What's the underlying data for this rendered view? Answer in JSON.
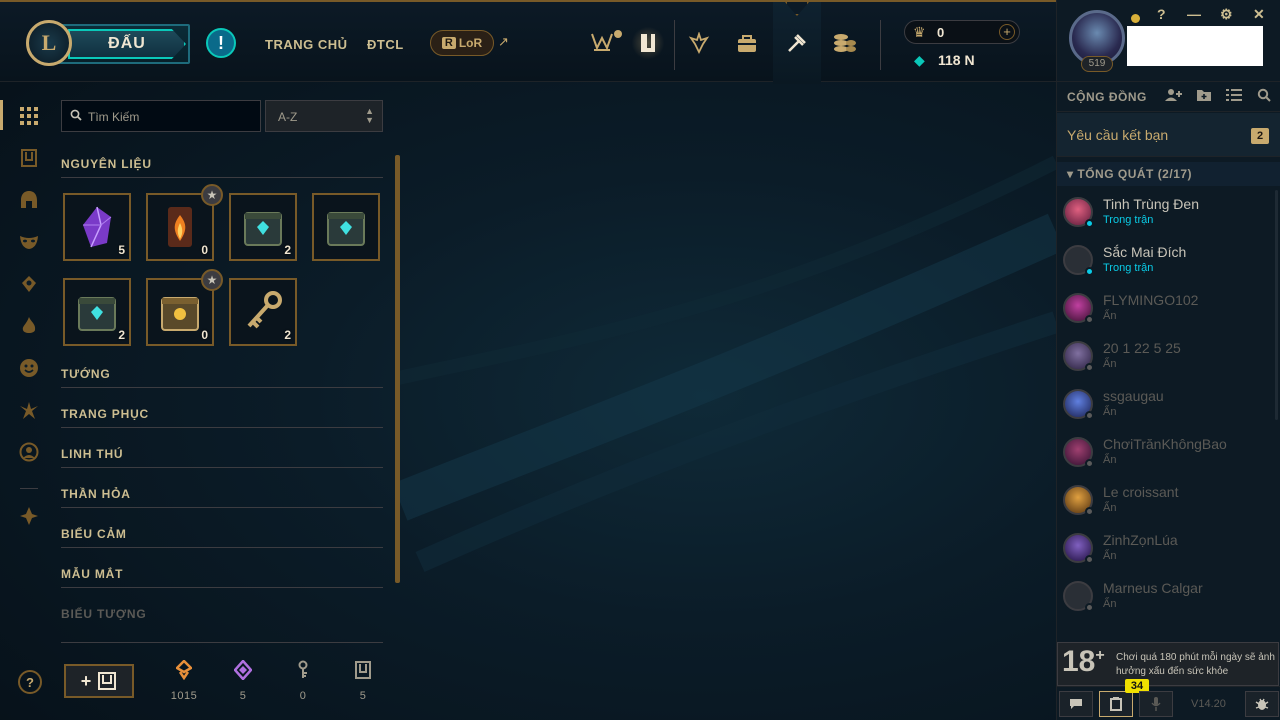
{
  "topbar": {
    "play_label": "ĐẤU",
    "nav": [
      {
        "label": "TRANG CHỦ"
      },
      {
        "label": "ĐTCL"
      }
    ],
    "lor_label": "LoR",
    "lor_badge": "R",
    "rp": "0",
    "be": "118 N"
  },
  "profile": {
    "level": "519",
    "window_controls": [
      "?",
      "—",
      "⚙",
      "✕"
    ]
  },
  "social": {
    "title": "CỘNG ĐỒNG",
    "friend_requests_label": "Yêu cầu kết bạn",
    "friend_requests_count": "2",
    "group_label": "TỔNG QUÁT (2/17)",
    "friends": [
      {
        "name": "Tinh Trùng Đen",
        "status": "Trong trận"
      },
      {
        "name": "Sắc Mai Đích",
        "status": "Trong trận"
      },
      {
        "name": "FLYMINGO102",
        "status": "Ẩn"
      },
      {
        "name": "20 1 22 5 25",
        "status": "Ẩn"
      },
      {
        "name": "ssgaugau",
        "status": "Ẩn"
      },
      {
        "name": "ChơiTrănKhôngBao",
        "status": "Ẩn"
      },
      {
        "name": "Le croissant",
        "status": "Ẩn"
      },
      {
        "name": "ZinhZọnLúa",
        "status": "Ẩn"
      },
      {
        "name": "Marneus Calgar",
        "status": "Ẩn"
      }
    ],
    "warning_age": "18",
    "warning_plus": "+",
    "warning_text": "Chơi quá 180 phút mỗi ngày sẽ ảnh hưởng xấu đến sức khỏe",
    "chat_badge": "34",
    "version": "V14.20"
  },
  "loot": {
    "search_placeholder": "Tìm Kiếm",
    "sort_value": "A-Z",
    "categories": [
      "NGUYÊN LIỆU",
      "TƯỚNG",
      "TRANG PHỤC",
      "LINH THÚ",
      "THẦN HỎA",
      "BIỂU CẢM",
      "MẪU MẮT",
      "BIỂU TƯỢNG"
    ],
    "items": [
      {
        "count": "5"
      },
      {
        "count": "0"
      },
      {
        "count": "2"
      },
      {
        "count": ""
      },
      {
        "count": "2"
      },
      {
        "count": "0"
      },
      {
        "count": "2"
      }
    ],
    "resources": [
      {
        "value": "1015",
        "color": "#e8903a"
      },
      {
        "value": "5",
        "color": "#b070e0"
      },
      {
        "value": "0",
        "color": "#a09b8c"
      },
      {
        "value": "5",
        "color": "#a09b8c"
      }
    ],
    "craft_label": "+"
  }
}
